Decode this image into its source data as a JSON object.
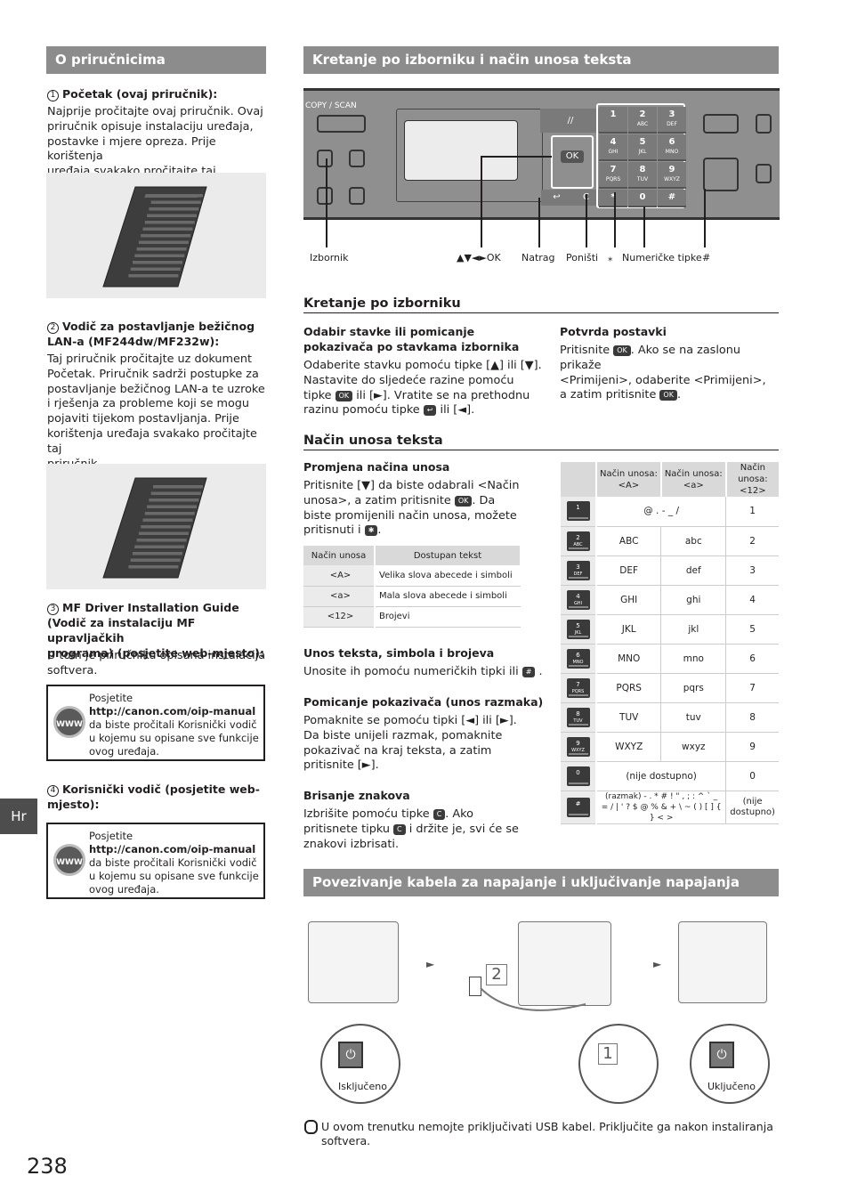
{
  "left": {
    "header": "O priručnicima",
    "items": [
      {
        "num": "1",
        "title": "Početak (ovaj priručnik):",
        "body": [
          "Najprije pročitajte ovaj priručnik. Ovaj",
          "priručnik opisuje instalaciju uređaja,",
          "postavke i mjere opreza. Prije korištenja",
          "uređaja svakako pročitajte taj priručnik."
        ]
      },
      {
        "num": "2",
        "title": [
          "Vodič za postavljanje bežičnog",
          "LAN-a (MF244dw/MF232w):"
        ],
        "body": [
          "Taj priručnik pročitajte uz dokument",
          "Početak. Priručnik sadrži postupke za",
          "postavljanje bežičnog LAN-a te uzroke",
          "i rješenja za probleme koji se mogu",
          "pojaviti tijekom postavljanja. Prije",
          "korištenja uređaja svakako pročitajte taj",
          "priručnik."
        ]
      },
      {
        "num": "3",
        "title": [
          "MF Driver Installation Guide",
          "(Vodič za instalaciju MF upravljačkih",
          "programa) (posjetite web-mjesto):"
        ],
        "body": [
          "U tom je priručniku opisana instalacija",
          "softvera."
        ]
      },
      {
        "num": "4",
        "title": [
          "Korisnički vodič (posjetite web-",
          "mjesto):"
        ]
      }
    ],
    "www_box": {
      "icon": "www-globe-icon",
      "icon_text": "WWW",
      "line1": "Posjetite",
      "url": "http://canon.com/oip-manual",
      "line3": "da biste pročitali Korisnički vodič",
      "line4": "u kojemu su opisane sve funkcije",
      "line5": "ovog uređaja."
    },
    "side_tab": "Hr"
  },
  "right": {
    "header1": "Kretanje po izborniku i način unosa teksta",
    "panel": {
      "copy_scan_label": "COPY / SCAN",
      "keys": [
        {
          "n": "1",
          "l": ""
        },
        {
          "n": "2",
          "l": "ABC"
        },
        {
          "n": "3",
          "l": "DEF"
        },
        {
          "n": "4",
          "l": "GHI"
        },
        {
          "n": "5",
          "l": "JKL"
        },
        {
          "n": "6",
          "l": "MNO"
        },
        {
          "n": "7",
          "l": "PQRS"
        },
        {
          "n": "8",
          "l": "TUV"
        },
        {
          "n": "9",
          "l": "WXYZ"
        },
        {
          "n": "0",
          "l": ""
        },
        {
          "n": "#",
          "l": ""
        },
        {
          "n": "*",
          "l": ""
        }
      ],
      "ok_label": "OK",
      "callouts": {
        "menu": "Izbornik",
        "arrows": "▲▼◄►OK",
        "back": "Natrag",
        "clear": "Poništi",
        "star": "⁎",
        "numeric": "Numeričke tipke",
        "hash": "#"
      }
    },
    "nav": {
      "title": "Kretanje po izborniku",
      "select_title": [
        "Odabir stavke ili pomicanje",
        "pokazivača po stavkama izbornika"
      ],
      "select_body": {
        "l1": "Odaberite stavku pomoću tipke [▲] ili [▼].",
        "l2": "Nastavite do sljedeće razine pomoću",
        "l3a": "tipke",
        "l3b": "ili [►]. Vratite se na prethodnu",
        "l4a": "razinu pomoću tipke",
        "l4b": "ili [◄]."
      },
      "confirm_title": "Potvrda postavki",
      "confirm_body": {
        "l1a": "Pritisnite",
        "l1b": ". Ako se na zaslonu prikaže",
        "l2": "<Primijeni>, odaberite <Primijeni>,",
        "l3a": "a zatim pritisnite",
        "l3b": "."
      }
    },
    "text_input": {
      "title": "Način unosa teksta",
      "change_title": "Promjena načina unosa",
      "change_body": {
        "l1": "Pritisnite [▼] da biste odabrali <Način",
        "l2a": "unosa>, a zatim pritisnite",
        "l2b": ". Da",
        "l3": "biste promijenili način unosa, možete",
        "l4a": "pritisnuti i",
        "l4b": "."
      },
      "mode_table": {
        "headers": [
          "Način unosa",
          "Dostupan tekst"
        ],
        "rows": [
          [
            "<A>",
            "Velika slova abecede i simboli"
          ],
          [
            "<a>",
            "Mala slova abecede i simboli"
          ],
          [
            "<12>",
            "Brojevi"
          ]
        ]
      },
      "enter_title": "Unos teksta, simbola i brojeva",
      "enter_body_a": "Unosite ih pomoću numeričkih tipki ili",
      "enter_body_b": ".",
      "move_title": "Pomicanje pokazivača (unos razmaka)",
      "move_body": [
        "Pomaknite se pomoću tipki [◄] ili [►].",
        "Da biste unijeli razmak, pomaknite",
        "pokazivač na kraj teksta, a zatim",
        "pritisnite [►]."
      ],
      "delete_title": "Brisanje znakova",
      "delete_body": {
        "l1a": "Izbrišite pomoću tipke",
        "l1b": ". Ako",
        "l2a": "pritisnete tipku",
        "l2b": "i držite je, svi će se",
        "l3": "znakovi izbrisati."
      },
      "key_table": {
        "headers": [
          [
            "Način unosa:",
            "<A>"
          ],
          [
            "Način unosa:",
            "<a>"
          ],
          [
            "Način unosa:",
            "<12>"
          ]
        ],
        "rows": [
          {
            "key": "1",
            "sub": "",
            "A": "@ . - _ /",
            "a": null,
            "n": "1"
          },
          {
            "key": "2",
            "sub": "ABC",
            "A": "ABC",
            "a": "abc",
            "n": "2"
          },
          {
            "key": "3",
            "sub": "DEF",
            "A": "DEF",
            "a": "def",
            "n": "3"
          },
          {
            "key": "4",
            "sub": "GHI",
            "A": "GHI",
            "a": "ghi",
            "n": "4"
          },
          {
            "key": "5",
            "sub": "JKL",
            "A": "JKL",
            "a": "jkl",
            "n": "5"
          },
          {
            "key": "6",
            "sub": "MNO",
            "A": "MNO",
            "a": "mno",
            "n": "6"
          },
          {
            "key": "7",
            "sub": "PQRS",
            "A": "PQRS",
            "a": "pqrs",
            "n": "7"
          },
          {
            "key": "8",
            "sub": "TUV",
            "A": "TUV",
            "a": "tuv",
            "n": "8"
          },
          {
            "key": "9",
            "sub": "WXYZ",
            "A": "WXYZ",
            "a": "wxyz",
            "n": "9"
          },
          {
            "key": "0",
            "sub": "",
            "A": "(nije dostupno)",
            "a": null,
            "n": "0"
          },
          {
            "key": "#",
            "sub": "",
            "A": "(razmak) - . * # ! \" , ; : ^ ` _ = / | ' ? $ @ % & + \\ ~ ( ) [ ] { } < >",
            "a": null,
            "n": "(nije dostupno)"
          }
        ]
      }
    },
    "header2": "Povezivanje kabela za napajanje i uključivanje napajanja",
    "power": {
      "off_label": "Isključeno",
      "on_label": "Uključeno",
      "step1": "1",
      "step2": "2",
      "arrow": "►"
    },
    "note": {
      "icon": "caution-hand-icon",
      "l1": "U ovom trenutku nemojte priključivati USB kabel. Priključite ga nakon instaliranja",
      "l2": "softvera."
    }
  },
  "page_number": "238",
  "key_glyphs": {
    "ok": "OK",
    "back": "↩",
    "star": "✱",
    "hash": "#",
    "clear": "C"
  }
}
